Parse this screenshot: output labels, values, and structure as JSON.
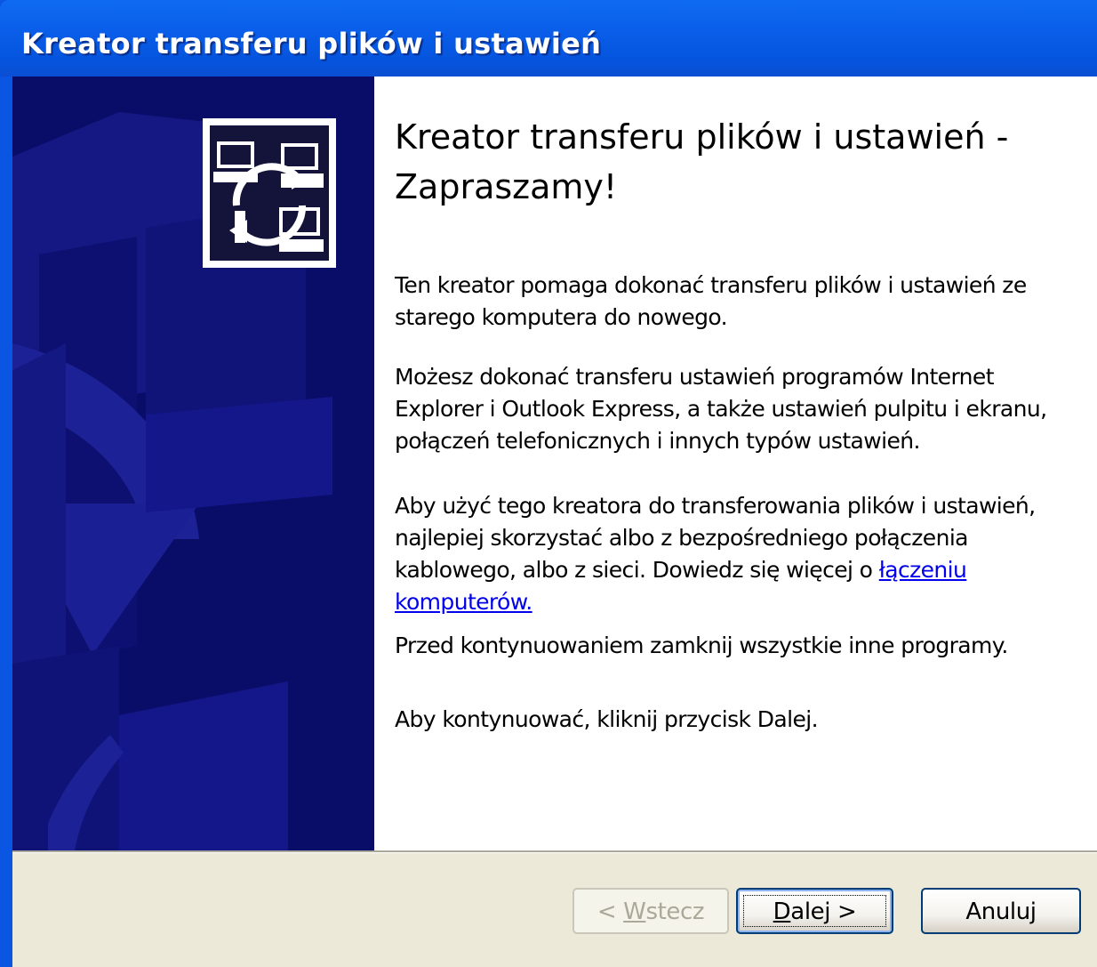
{
  "window": {
    "title": "Kreator transferu plików i ustawień"
  },
  "sidebar": {
    "icon": "wizard-transfer-icon"
  },
  "content": {
    "heading_line1": "Kreator transferu plików i ustawień -",
    "heading_line2": "Zapraszamy!",
    "p1": "Ten kreator pomaga dokonać transferu plików i ustawień ze starego komputera do nowego.",
    "p2": "Możesz dokonać transferu ustawień programów Internet Explorer i Outlook Express, a także ustawień pulpitu i ekranu, połączeń telefonicznych i innych typów ustawień.",
    "p3_text": "Aby użyć tego kreatora do transferowania plików i ustawień, najlepiej skorzystać albo z bezpośredniego połączenia kablowego, albo z sieci. Dowiedz się więcej o",
    "p3_link": "łączeniu komputerów.",
    "p4": "Przed kontynuowaniem zamknij wszystkie inne programy.",
    "p5": "Aby kontynuować, kliknij przycisk Dalej."
  },
  "buttons": {
    "back_prefix": "< ",
    "back_accel": "W",
    "back_rest": "stecz",
    "next_accel": "D",
    "next_rest": "alej >",
    "cancel": "Anuluj"
  },
  "colors": {
    "titlebar": "#0a5ee9",
    "sidebar": "#0a0d68",
    "dialog_face": "#ece9d8",
    "link": "#0000ee"
  }
}
